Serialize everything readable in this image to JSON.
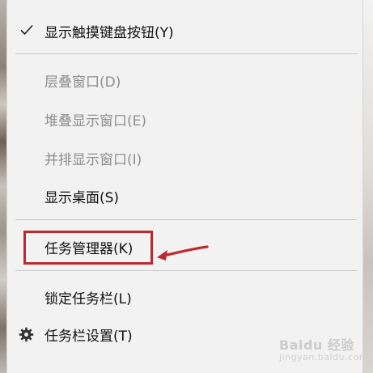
{
  "menu": {
    "items": [
      {
        "label": "显示触摸键盘按钮(Y)",
        "checked": true,
        "disabled": false
      },
      {
        "label": "层叠窗口(D)",
        "disabled": true
      },
      {
        "label": "堆叠显示窗口(E)",
        "disabled": true
      },
      {
        "label": "并排显示窗口(I)",
        "disabled": true
      },
      {
        "label": "显示桌面(S)",
        "disabled": false
      },
      {
        "label": "任务管理器(K)",
        "disabled": false,
        "highlighted": true
      },
      {
        "label": "锁定任务栏(L)",
        "disabled": false
      },
      {
        "label": "任务栏设置(T)",
        "disabled": false,
        "icon": "gear-icon"
      }
    ]
  },
  "annotation": {
    "highlight_color": "#c0282d"
  },
  "watermark": {
    "text": "Baidu 经验",
    "subtext": "jingyan.baidu.com"
  }
}
